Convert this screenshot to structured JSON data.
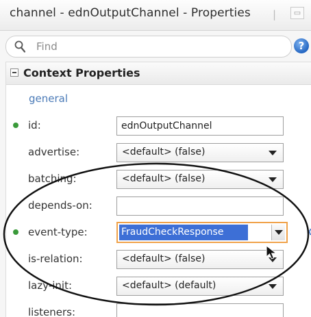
{
  "window": {
    "title": "channel - ednOutputChannel - Properties",
    "title_separator": "|",
    "restore_glyph": "▭"
  },
  "search": {
    "placeholder": "Find",
    "icon": "search-icon"
  },
  "help": {
    "glyph": "?",
    "icon": "help-icon"
  },
  "section": {
    "title": "Context Properties",
    "expanded": true
  },
  "group": {
    "label": "general"
  },
  "properties": [
    {
      "key": "id",
      "label": "id:",
      "type": "text",
      "value": "ednOutputChannel",
      "required": true
    },
    {
      "key": "advertise",
      "label": "advertise:",
      "type": "select",
      "value": "<default> (false)",
      "required": false
    },
    {
      "key": "batching",
      "label": "batching:",
      "type": "select",
      "value": "<default> (false)",
      "required": false
    },
    {
      "key": "depends-on",
      "label": "depends-on:",
      "type": "text",
      "value": "",
      "required": false
    },
    {
      "key": "event-type",
      "label": "event-type:",
      "type": "select-active",
      "value": "FraudCheckResponse",
      "required": true,
      "has_gear": true
    },
    {
      "key": "is-relation",
      "label": "is-relation:",
      "type": "select",
      "value": "<default> (false)",
      "required": false
    },
    {
      "key": "lazy-init",
      "label": "lazy-init:",
      "type": "select",
      "value": "<default> (default)",
      "required": false
    },
    {
      "key": "listeners",
      "label": "listeners:",
      "type": "text",
      "value": "",
      "required": false
    }
  ],
  "colors": {
    "required_dot": "#3a9a3a",
    "group_label": "#4a7ab7",
    "selection": "#3d6fd6",
    "focus_border": "#f0a24a",
    "gear": "#3a6fc9"
  },
  "gear_glyph": "⚙"
}
